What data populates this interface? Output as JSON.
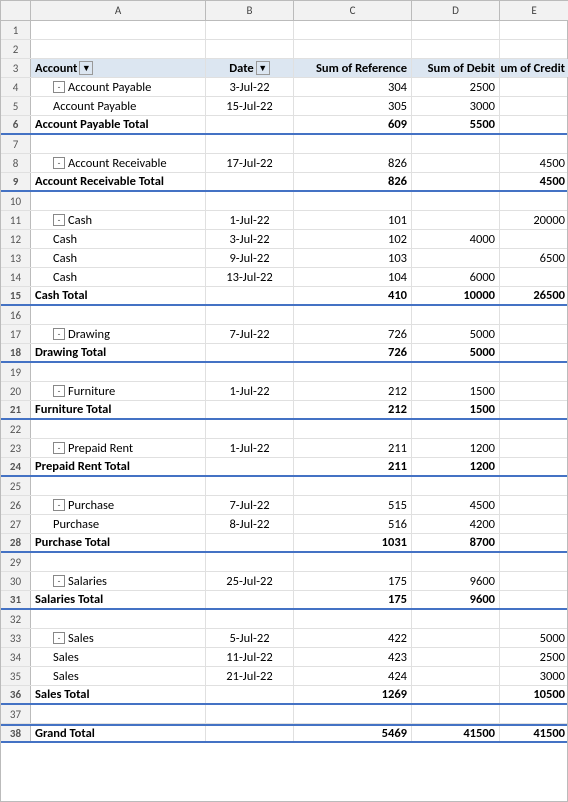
{
  "columns": [
    "A",
    "B",
    "C",
    "D",
    "E"
  ],
  "header": {
    "col_a": "Account",
    "col_b": "Date",
    "col_c": "Sum of Reference",
    "col_d": "Sum of Debit",
    "col_e": "Sum of Credit"
  },
  "rows": [
    {
      "num": 1,
      "type": "empty"
    },
    {
      "num": 2,
      "type": "empty"
    },
    {
      "num": 3,
      "type": "header"
    },
    {
      "num": 4,
      "type": "data",
      "indent": true,
      "expand": true,
      "a": "Account Payable",
      "b": "3-Jul-22",
      "c": "304",
      "d": "2500",
      "e": ""
    },
    {
      "num": 5,
      "type": "data",
      "indent": true,
      "expand": false,
      "a": "Account Payable",
      "b": "15-Jul-22",
      "c": "305",
      "d": "3000",
      "e": ""
    },
    {
      "num": 6,
      "type": "total",
      "a": "Account Payable  Total",
      "b": "",
      "c": "609",
      "d": "5500",
      "e": ""
    },
    {
      "num": 7,
      "type": "empty"
    },
    {
      "num": 8,
      "type": "data",
      "indent": true,
      "expand": true,
      "a": "Account Receivable",
      "b": "17-Jul-22",
      "c": "826",
      "d": "",
      "e": "4500"
    },
    {
      "num": 9,
      "type": "total",
      "a": "Account Receivable  Total",
      "b": "",
      "c": "826",
      "d": "",
      "e": "4500"
    },
    {
      "num": 10,
      "type": "empty"
    },
    {
      "num": 11,
      "type": "data",
      "indent": true,
      "expand": true,
      "a": "Cash",
      "b": "1-Jul-22",
      "c": "101",
      "d": "",
      "e": "20000"
    },
    {
      "num": 12,
      "type": "data",
      "indent": true,
      "expand": false,
      "a": "Cash",
      "b": "3-Jul-22",
      "c": "102",
      "d": "4000",
      "e": ""
    },
    {
      "num": 13,
      "type": "data",
      "indent": true,
      "expand": false,
      "a": "Cash",
      "b": "9-Jul-22",
      "c": "103",
      "d": "",
      "e": "6500"
    },
    {
      "num": 14,
      "type": "data",
      "indent": true,
      "expand": false,
      "a": "Cash",
      "b": "13-Jul-22",
      "c": "104",
      "d": "6000",
      "e": ""
    },
    {
      "num": 15,
      "type": "total",
      "a": "Cash  Total",
      "b": "",
      "c": "410",
      "d": "10000",
      "e": "26500"
    },
    {
      "num": 16,
      "type": "empty"
    },
    {
      "num": 17,
      "type": "data",
      "indent": true,
      "expand": true,
      "a": "Drawing",
      "b": "7-Jul-22",
      "c": "726",
      "d": "5000",
      "e": ""
    },
    {
      "num": 18,
      "type": "total",
      "a": "Drawing  Total",
      "b": "",
      "c": "726",
      "d": "5000",
      "e": ""
    },
    {
      "num": 19,
      "type": "empty"
    },
    {
      "num": 20,
      "type": "data",
      "indent": true,
      "expand": true,
      "a": "Furniture",
      "b": "1-Jul-22",
      "c": "212",
      "d": "1500",
      "e": ""
    },
    {
      "num": 21,
      "type": "total",
      "a": "Furniture  Total",
      "b": "",
      "c": "212",
      "d": "1500",
      "e": ""
    },
    {
      "num": 22,
      "type": "empty"
    },
    {
      "num": 23,
      "type": "data",
      "indent": true,
      "expand": true,
      "a": "Prepaid Rent",
      "b": "1-Jul-22",
      "c": "211",
      "d": "1200",
      "e": ""
    },
    {
      "num": 24,
      "type": "total",
      "a": "Prepaid Rent  Total",
      "b": "",
      "c": "211",
      "d": "1200",
      "e": ""
    },
    {
      "num": 25,
      "type": "empty"
    },
    {
      "num": 26,
      "type": "data",
      "indent": true,
      "expand": true,
      "a": "Purchase",
      "b": "7-Jul-22",
      "c": "515",
      "d": "4500",
      "e": ""
    },
    {
      "num": 27,
      "type": "data",
      "indent": true,
      "expand": false,
      "a": "Purchase",
      "b": "8-Jul-22",
      "c": "516",
      "d": "4200",
      "e": ""
    },
    {
      "num": 28,
      "type": "total",
      "a": "Purchase  Total",
      "b": "",
      "c": "1031",
      "d": "8700",
      "e": ""
    },
    {
      "num": 29,
      "type": "empty"
    },
    {
      "num": 30,
      "type": "data",
      "indent": true,
      "expand": true,
      "a": "Salaries",
      "b": "25-Jul-22",
      "c": "175",
      "d": "9600",
      "e": ""
    },
    {
      "num": 31,
      "type": "total",
      "a": "Salaries  Total",
      "b": "",
      "c": "175",
      "d": "9600",
      "e": ""
    },
    {
      "num": 32,
      "type": "empty"
    },
    {
      "num": 33,
      "type": "data",
      "indent": true,
      "expand": true,
      "a": "Sales",
      "b": "5-Jul-22",
      "c": "422",
      "d": "",
      "e": "5000"
    },
    {
      "num": 34,
      "type": "data",
      "indent": true,
      "expand": false,
      "a": "Sales",
      "b": "11-Jul-22",
      "c": "423",
      "d": "",
      "e": "2500"
    },
    {
      "num": 35,
      "type": "data",
      "indent": true,
      "expand": false,
      "a": "Sales",
      "b": "21-Jul-22",
      "c": "424",
      "d": "",
      "e": "3000"
    },
    {
      "num": 36,
      "type": "total",
      "a": "Sales Total",
      "b": "",
      "c": "1269",
      "d": "",
      "e": "10500"
    },
    {
      "num": 37,
      "type": "empty"
    },
    {
      "num": 38,
      "type": "grand",
      "a": "Grand Total",
      "b": "",
      "c": "5469",
      "d": "41500",
      "e": "41500"
    }
  ]
}
